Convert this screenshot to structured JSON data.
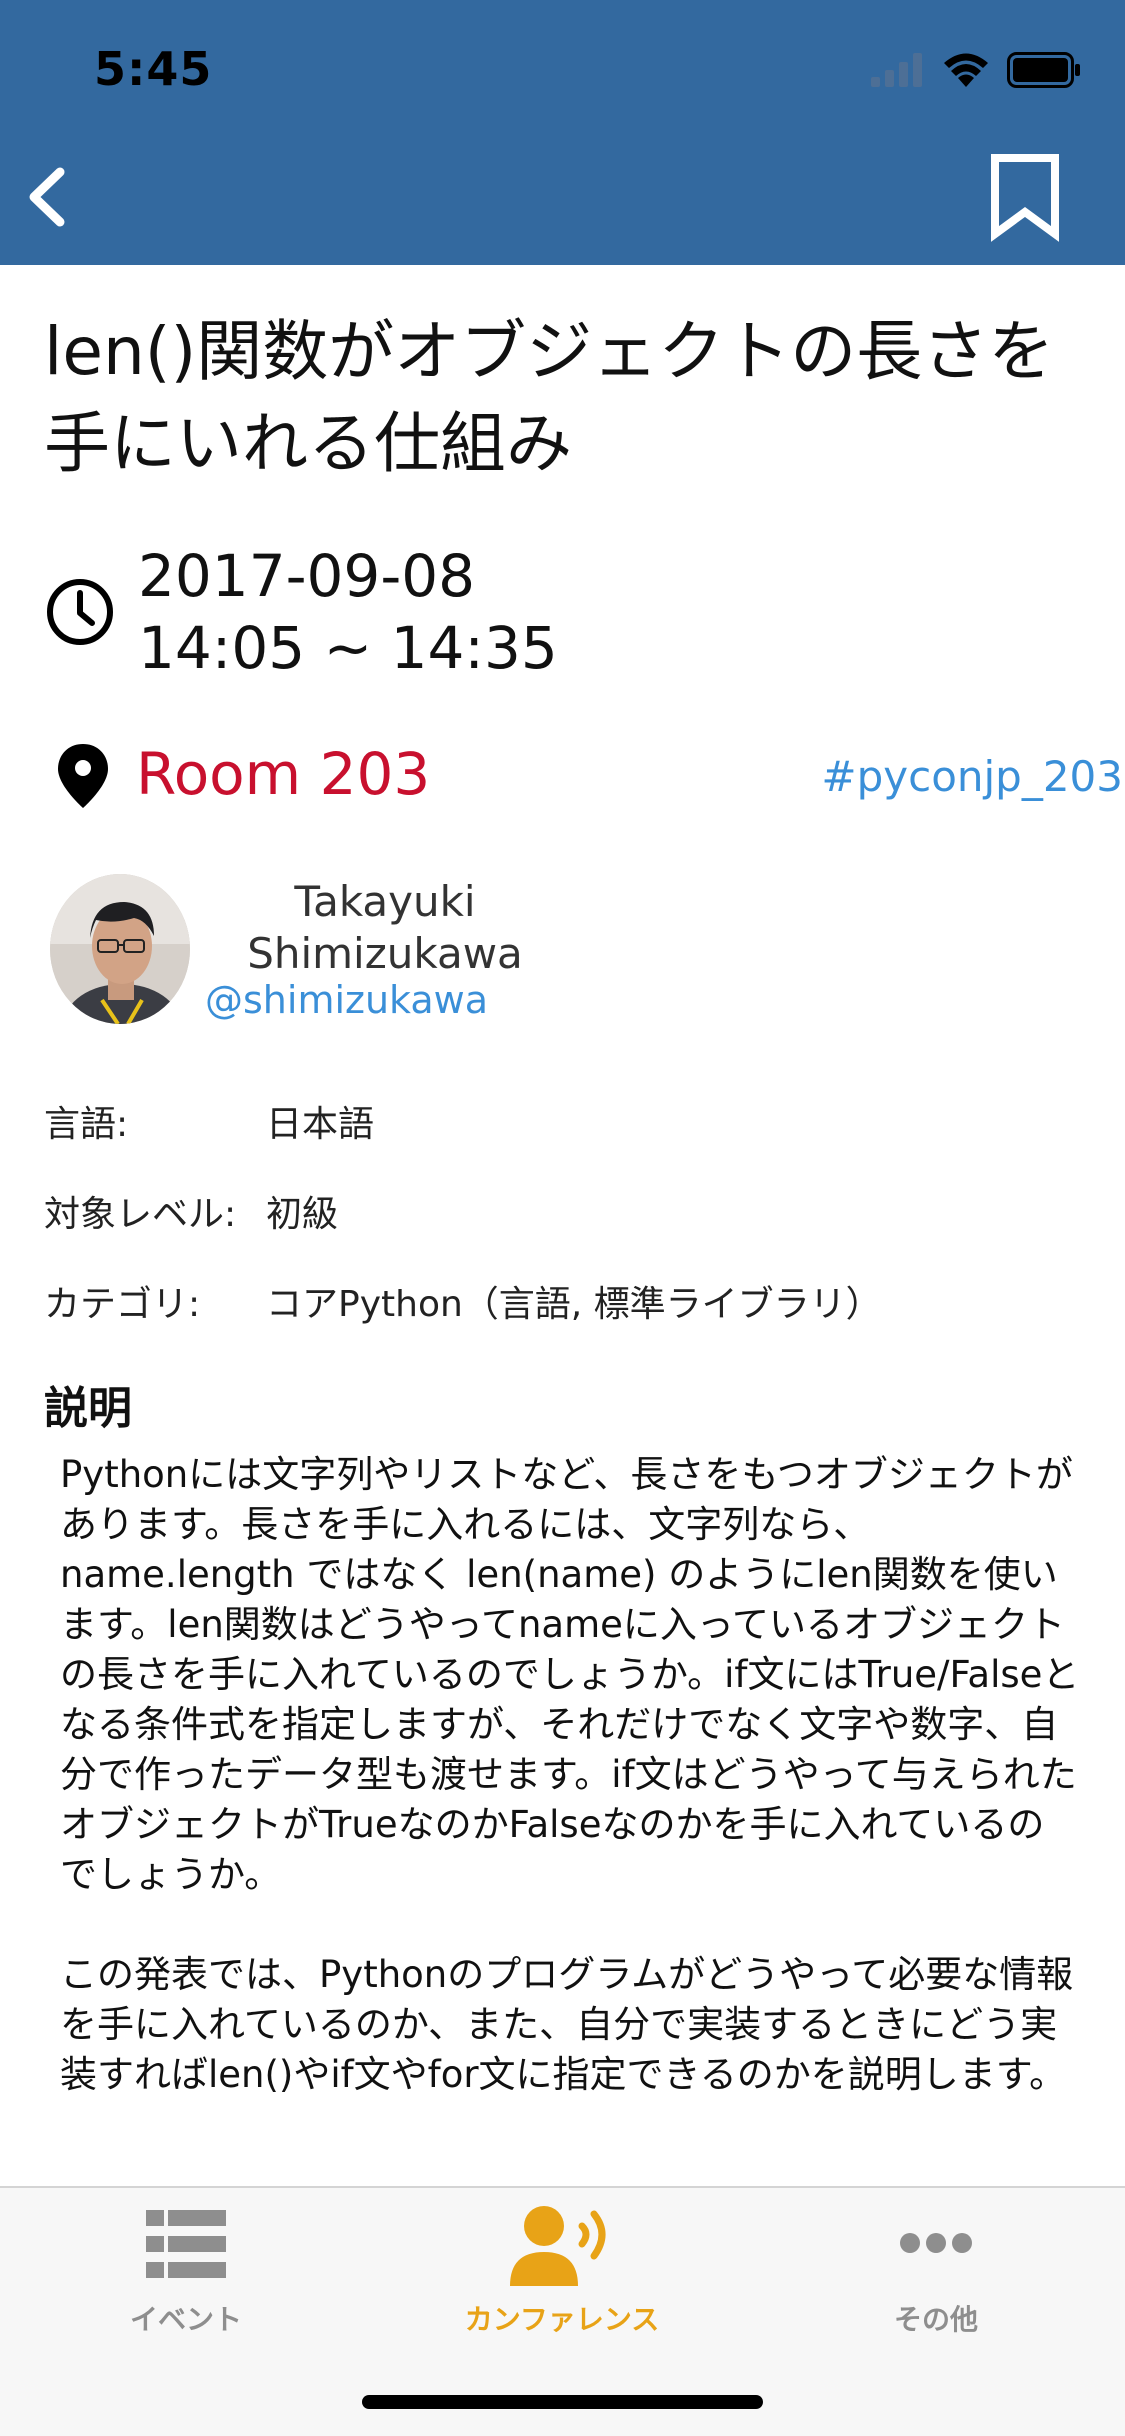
{
  "status_bar": {
    "time": "5:45"
  },
  "nav": {
    "back_icon": "chevron-left-icon",
    "bookmark_icon": "bookmark-icon"
  },
  "session": {
    "title": "len()関数がオブジェクトの長さを手にいれる仕組み",
    "date": "2017-09-08",
    "time_range": "14:05 ~ 14:35",
    "room": "Room 203",
    "hashtag": "#pyconjp_203"
  },
  "speaker": {
    "name": "Takayuki Shimizukawa",
    "handle": "@shimizukawa"
  },
  "meta": {
    "language_label": "言語:",
    "language_value": "日本語",
    "level_label": "対象レベル:",
    "level_value": "初級",
    "category_label": "カテゴリ:",
    "category_value": "コアPython（言語, 標準ライブラリ）"
  },
  "description": {
    "heading": "説明",
    "paragraph1": "Pythonには文字列やリストなど、長さをもつオブジェクトがあります。長さを手に入れるには、文字列なら、name.length ではなく len(name) のようにlen関数を使います。len関数はどうやってnameに入っているオブジェクトの長さを手に入れているのでしょうか。if文にはTrue/Falseとなる条件式を指定しますが、それだけでなく文字や数字、自分で作ったデータ型も渡せます。if文はどうやって与えられたオブジェクトがTrueなのかFalseなのかを手に入れているのでしょうか。",
    "paragraph2": "この発表では、Pythonのプログラムがどうやって必要な情報を手に入れているのか、また、自分で実装するときにどう実装すればlen()やif文やfor文に指定できるのかを説明します。"
  },
  "tabs": [
    {
      "label": "イベント",
      "icon": "list-icon",
      "active": false
    },
    {
      "label": "カンファレンス",
      "icon": "speaker-icon",
      "active": true
    },
    {
      "label": "その他",
      "icon": "more-icon",
      "active": false
    }
  ],
  "colors": {
    "header": "#33699f",
    "room": "#c8102e",
    "link": "#3a8fd8",
    "tab_active": "#e8a317",
    "tab_inactive": "#8e8e8e"
  }
}
